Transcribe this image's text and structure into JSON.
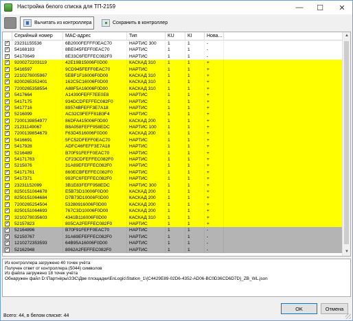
{
  "window": {
    "title": "Настройка белого списка для ТП-2159",
    "minimize": "—",
    "maximize": "☐",
    "close": "✕"
  },
  "toolbar": {
    "read_label": "Вычитать из контроллера",
    "save_label": "Сохранить в контроллер"
  },
  "table": {
    "columns": [
      "Серийный номер",
      "MAC-адрес",
      "Тип",
      "KU",
      "KI",
      "Нова..."
    ],
    "rows": [
      {
        "serial": "23231155536",
        "mac": "6B2000FEFFF0EAC70",
        "type": "НАРТИС 300",
        "ku": "1",
        "ki": "1",
        "new": "-",
        "color": "white"
      },
      {
        "serial": "54168183",
        "mac": "8BE045FEFF0EAC70",
        "type": "НАРТИС",
        "ku": "1",
        "ki": "1",
        "new": "-",
        "color": "white"
      },
      {
        "serial": "54170649",
        "mac": "8E33C6FEFFEC082F0",
        "type": "НАРТИС",
        "ku": "1",
        "ki": "1",
        "new": "-",
        "color": "white"
      },
      {
        "serial": "9200272203119",
        "mac": "42E19B15006F0D00",
        "type": "КАСКАД 310",
        "ku": "1",
        "ki": "1",
        "new": "+",
        "color": "yellow"
      },
      {
        "serial": "5416597",
        "mac": "9CD945FEFF0EAC70",
        "type": "НАРТИС",
        "ku": "1",
        "ki": "1",
        "new": "+",
        "color": "yellow"
      },
      {
        "serial": "2210278005967",
        "mac": "5EBF1F16006F0D00",
        "type": "КАСКАД 310",
        "ku": "1",
        "ki": "1",
        "new": "+",
        "color": "yellow"
      },
      {
        "serial": "8200265352401",
        "mac": "162C5C16006F0D00",
        "type": "КАСКАД 310",
        "ku": "1",
        "ki": "1",
        "new": "+",
        "color": "yellow"
      },
      {
        "serial": "7200265358554",
        "mac": "A88F5A16006F0D00",
        "type": "КАСКАД 310",
        "ku": "1",
        "ki": "1",
        "new": "+",
        "color": "yellow"
      },
      {
        "serial": "5417664",
        "mac": "A14390FEFF7EE0E8",
        "type": "НАРТИС",
        "ku": "1",
        "ki": "1",
        "new": "+",
        "color": "yellow"
      },
      {
        "serial": "5417175",
        "mac": "934DCDFEFFEC082F0",
        "type": "НАРТИС",
        "ku": "1",
        "ki": "1",
        "new": "+",
        "color": "yellow"
      },
      {
        "serial": "5417716",
        "mac": "89574BFEFF3E7A18",
        "type": "НАРТИС",
        "ku": "1",
        "ki": "1",
        "new": "+",
        "color": "yellow"
      },
      {
        "serial": "5216099",
        "mac": "AC32C9FEFF81B3F4",
        "type": "НАРТИС",
        "ku": "1",
        "ki": "1",
        "new": "+",
        "color": "yellow"
      },
      {
        "serial": "7200139854977",
        "mac": "86DFA415006F0D00",
        "type": "КАСКАД 200",
        "ku": "1",
        "ki": "1",
        "new": "+",
        "color": "yellow"
      },
      {
        "serial": "21231149067",
        "mac": "B8A058FEFF958EDC",
        "type": "НАРТИС 100",
        "ku": "1",
        "ki": "1",
        "new": "+",
        "color": "yellow"
      },
      {
        "serial": "7200139854679",
        "mac": "F63D4516006F0D00",
        "type": "КАСКАД 200",
        "ku": "1",
        "ki": "1",
        "new": "+",
        "color": "yellow"
      },
      {
        "serial": "5416691",
        "mac": "5FC52DFEFF0EAC70",
        "type": "НАРТИС",
        "ku": "1",
        "ki": "1",
        "new": "+",
        "color": "yellow"
      },
      {
        "serial": "5417928",
        "mac": "ADFC46FEFF3E7A18",
        "type": "НАРТИС",
        "ku": "1",
        "ki": "1",
        "new": "+",
        "color": "yellow"
      },
      {
        "serial": "5216489",
        "mac": "B70F91FEFF0EAC70",
        "type": "НАРТИС",
        "ku": "1",
        "ki": "1",
        "new": "+",
        "color": "yellow"
      },
      {
        "serial": "54171763",
        "mac": "CF23CDFEFFEC082F0",
        "type": "НАРТИС",
        "ku": "1",
        "ki": "1",
        "new": "+",
        "color": "yellow"
      },
      {
        "serial": "5215076",
        "mac": "31A69EFEFFEC082F0",
        "type": "НАРТИС",
        "ku": "1",
        "ki": "1",
        "new": "+",
        "color": "yellow"
      },
      {
        "serial": "54171761",
        "mac": "860ECBFEFFEC082F0",
        "type": "НАРТИС",
        "ku": "1",
        "ki": "1",
        "new": "+",
        "color": "yellow"
      },
      {
        "serial": "5417371",
        "mac": "992FC6FEFFEC082F0",
        "type": "НАРТИС",
        "ku": "1",
        "ki": "1",
        "new": "+",
        "color": "yellow"
      },
      {
        "serial": "23231152099",
        "mac": "3B1E83FEFF958EDC",
        "type": "НАРТИС 300",
        "ku": "1",
        "ki": "1",
        "new": "+",
        "color": "yellow"
      },
      {
        "serial": "8250151064678",
        "mac": "E5B73D10006F0D00",
        "type": "КАСКАД 200",
        "ku": "1",
        "ki": "1",
        "new": "+",
        "color": "yellow"
      },
      {
        "serial": "8250151064684",
        "mac": "D7B73D10006F0D00",
        "type": "КАСКАД 200",
        "ku": "1",
        "ki": "1",
        "new": "+",
        "color": "yellow"
      },
      {
        "serial": "7200265254504",
        "mac": "53280916006F0D00",
        "type": "КАСКАД 200",
        "ku": "1",
        "ki": "1",
        "new": "+",
        "color": "yellow"
      },
      {
        "serial": "8250151064693",
        "mac": "767C3D10006F0D00",
        "type": "КАСКАД 200",
        "ku": "1",
        "ki": "1",
        "new": "+",
        "color": "yellow"
      },
      {
        "serial": "3210278035603",
        "mac": "4341B116006F0D00",
        "type": "КАСКАД 310",
        "ku": "1",
        "ki": "1",
        "new": "+",
        "color": "yellow"
      },
      {
        "serial": "52157823",
        "mac": "805CA2FEFFEC082F0",
        "type": "НАРТИС",
        "ku": "1",
        "ki": "1",
        "new": "+",
        "color": "yellow"
      },
      {
        "serial": "52164896",
        "mac": "B70F91FEFF0EAC70",
        "type": "НАРТИС",
        "ku": "1",
        "ki": "1",
        "new": "-",
        "color": "gray"
      },
      {
        "serial": "52150767",
        "mac": "31A69EFEFFEC082F0",
        "type": "НАРТИС",
        "ku": "1",
        "ki": "1",
        "new": "-",
        "color": "gray"
      },
      {
        "serial": "1210272353593",
        "mac": "64B95A16006F0D00",
        "type": "НАРТИС",
        "ku": "1",
        "ki": "1",
        "new": "-",
        "color": "gray"
      },
      {
        "serial": "52162948",
        "mac": "8062A2FEFFEC082F0",
        "type": "НАРТИС",
        "ku": "1",
        "ki": "1",
        "new": "-",
        "color": "gray"
      }
    ]
  },
  "log": {
    "lines": [
      "Из контроллера загружено 40 точек учёта",
      "Получен ответ от контроллера (5044) символов",
      "Из файла загружено 18 точек учёта",
      "Обнаружен файл D:\\Партнёры\\ЗЭС\\Две площадки\\EnLogic\\Station_1\\{C4429E89-02D6-4352-AD06-BC0D36CD6D7D}_ZB_WL.json"
    ]
  },
  "status": "Всего: 44, в белом списке: 44",
  "buttons": {
    "ok": "OK",
    "cancel": "Отмена"
  },
  "colors": {
    "new_row": "#ffff00",
    "removed_row": "#b4b4b4",
    "accent": "#0078d7"
  }
}
